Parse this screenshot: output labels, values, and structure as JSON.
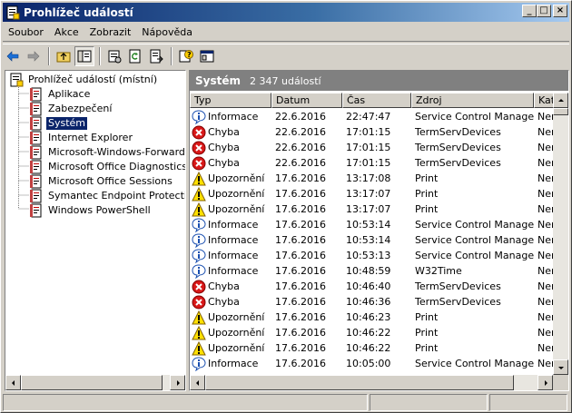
{
  "window": {
    "title": "Prohlížeč událostí",
    "buttons": {
      "minimize": "_",
      "maximize": "□",
      "close": "×"
    }
  },
  "menu": [
    {
      "label": "Soubor"
    },
    {
      "label": "Akce"
    },
    {
      "label": "Zobrazit"
    },
    {
      "label": "Nápověda"
    }
  ],
  "toolbar": [
    "back-arrow-icon",
    "forward-arrow-icon",
    "up-folder-icon",
    "show-hide-tree-icon",
    "properties-icon",
    "refresh-icon",
    "export-list-icon",
    "help-icon",
    "console-icon"
  ],
  "tree": {
    "root": "Prohlížeč událostí (místní)",
    "items": [
      {
        "label": "Aplikace",
        "selected": false
      },
      {
        "label": "Zabezpečení",
        "selected": false
      },
      {
        "label": "Systém",
        "selected": true
      },
      {
        "label": "Internet Explorer",
        "selected": false
      },
      {
        "label": "Microsoft-Windows-Forwarding/",
        "selected": false
      },
      {
        "label": "Microsoft Office Diagnostics",
        "selected": false
      },
      {
        "label": "Microsoft Office Sessions",
        "selected": false
      },
      {
        "label": "Symantec Endpoint Protection C",
        "selected": false
      },
      {
        "label": "Windows PowerShell",
        "selected": false
      }
    ]
  },
  "panel": {
    "title": "Systém",
    "count": "2 347 událostí",
    "columns": [
      "Typ",
      "Datum",
      "Čas",
      "Zdroj",
      "Kat"
    ],
    "events": [
      {
        "type": "Informace",
        "kind": "info",
        "date": "22.6.2016",
        "time": "22:47:47",
        "source": "Service Control Manager",
        "category": "Nen"
      },
      {
        "type": "Chyba",
        "kind": "error",
        "date": "22.6.2016",
        "time": "17:01:15",
        "source": "TermServDevices",
        "category": "Nen"
      },
      {
        "type": "Chyba",
        "kind": "error",
        "date": "22.6.2016",
        "time": "17:01:15",
        "source": "TermServDevices",
        "category": "Nen"
      },
      {
        "type": "Chyba",
        "kind": "error",
        "date": "22.6.2016",
        "time": "17:01:15",
        "source": "TermServDevices",
        "category": "Nen"
      },
      {
        "type": "Upozornění",
        "kind": "warning",
        "date": "17.6.2016",
        "time": "13:17:08",
        "source": "Print",
        "category": "Nen"
      },
      {
        "type": "Upozornění",
        "kind": "warning",
        "date": "17.6.2016",
        "time": "13:17:07",
        "source": "Print",
        "category": "Nen"
      },
      {
        "type": "Upozornění",
        "kind": "warning",
        "date": "17.6.2016",
        "time": "13:17:07",
        "source": "Print",
        "category": "Nen"
      },
      {
        "type": "Informace",
        "kind": "info",
        "date": "17.6.2016",
        "time": "10:53:14",
        "source": "Service Control Manager",
        "category": "Nen"
      },
      {
        "type": "Informace",
        "kind": "info",
        "date": "17.6.2016",
        "time": "10:53:14",
        "source": "Service Control Manager",
        "category": "Nen"
      },
      {
        "type": "Informace",
        "kind": "info",
        "date": "17.6.2016",
        "time": "10:53:13",
        "source": "Service Control Manager",
        "category": "Nen"
      },
      {
        "type": "Informace",
        "kind": "info",
        "date": "17.6.2016",
        "time": "10:48:59",
        "source": "W32Time",
        "category": "Nen"
      },
      {
        "type": "Chyba",
        "kind": "error",
        "date": "17.6.2016",
        "time": "10:46:40",
        "source": "TermServDevices",
        "category": "Nen"
      },
      {
        "type": "Chyba",
        "kind": "error",
        "date": "17.6.2016",
        "time": "10:46:36",
        "source": "TermServDevices",
        "category": "Nen"
      },
      {
        "type": "Upozornění",
        "kind": "warning",
        "date": "17.6.2016",
        "time": "10:46:23",
        "source": "Print",
        "category": "Nen"
      },
      {
        "type": "Upozornění",
        "kind": "warning",
        "date": "17.6.2016",
        "time": "10:46:22",
        "source": "Print",
        "category": "Nen"
      },
      {
        "type": "Upozornění",
        "kind": "warning",
        "date": "17.6.2016",
        "time": "10:46:22",
        "source": "Print",
        "category": "Nen"
      },
      {
        "type": "Informace",
        "kind": "info",
        "date": "17.6.2016",
        "time": "10:05:00",
        "source": "Service Control Manager",
        "category": "Nen"
      }
    ]
  },
  "colors": {
    "title_gradient_start": "#0a246a",
    "title_gradient_end": "#a6caf0",
    "selection": "#0a246a",
    "panel_header": "#808080"
  }
}
